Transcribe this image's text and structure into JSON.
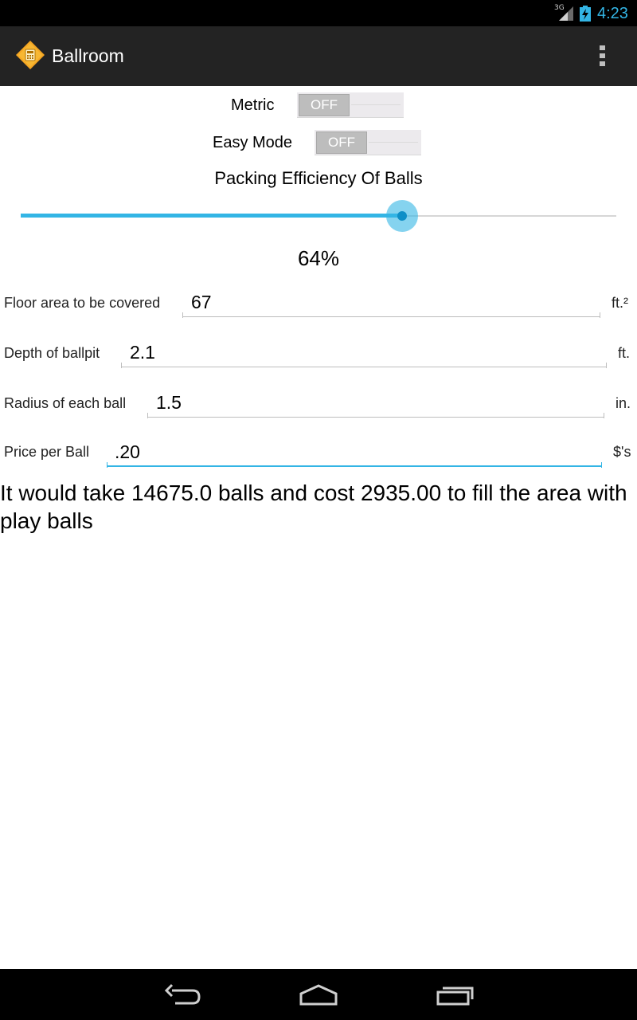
{
  "status_bar": {
    "network": "3G",
    "time": "4:23",
    "icons": [
      "signal-icon",
      "battery-charging-icon"
    ]
  },
  "action_bar": {
    "title": "Ballroom",
    "icons": [
      "app-icon",
      "overflow-menu-icon"
    ]
  },
  "toggles": {
    "metric": {
      "label": "Metric",
      "state": "OFF"
    },
    "easy_mode": {
      "label": "Easy Mode",
      "state": "OFF"
    }
  },
  "packing": {
    "title": "Packing Efficiency Of Balls",
    "value": 0.64,
    "display": "64%"
  },
  "fields": {
    "floor_area": {
      "label": "Floor area to be covered",
      "value": "67",
      "unit": "ft.²"
    },
    "depth": {
      "label": "Depth of ballpit",
      "value": "2.1",
      "unit": "ft."
    },
    "radius": {
      "label": "Radius of each ball",
      "value": "1.5",
      "unit": "in."
    },
    "price": {
      "label": "Price per Ball",
      "value": ".20",
      "unit": "$'s"
    }
  },
  "result": "It would take 14675.0 balls and cost 2935.00 to fill the area with play balls",
  "nav_bar": {
    "icons": [
      "back-icon",
      "home-icon",
      "recent-apps-icon"
    ]
  },
  "colors": {
    "accent": "#33b5e5",
    "action_bar": "#232323",
    "app_icon": "#f5a623"
  }
}
